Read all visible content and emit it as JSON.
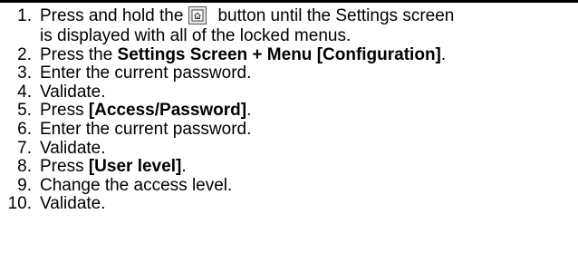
{
  "steps": [
    {
      "num": "1.",
      "pre": "Press and hold the",
      "icon": "home-button-icon",
      "post": "button until the Settings screen",
      "cont": "is displayed with all of the locked menus."
    },
    {
      "num": "2.",
      "pre": "Press the ",
      "bold": "Settings Screen + Menu [Configuration]",
      "post": "."
    },
    {
      "num": "3.",
      "pre": "Enter the current password."
    },
    {
      "num": "4.",
      "pre": "Validate."
    },
    {
      "num": "5.",
      "pre": "Press ",
      "bold": "[Access/Password]",
      "post": "."
    },
    {
      "num": "6.",
      "pre": "Enter the current password."
    },
    {
      "num": "7.",
      "pre": "Validate."
    },
    {
      "num": "8.",
      "pre": "Press ",
      "bold": "[User level]",
      "post": "."
    },
    {
      "num": "9.",
      "pre": "Change the access level."
    },
    {
      "num": "10.",
      "pre": "Validate."
    }
  ]
}
